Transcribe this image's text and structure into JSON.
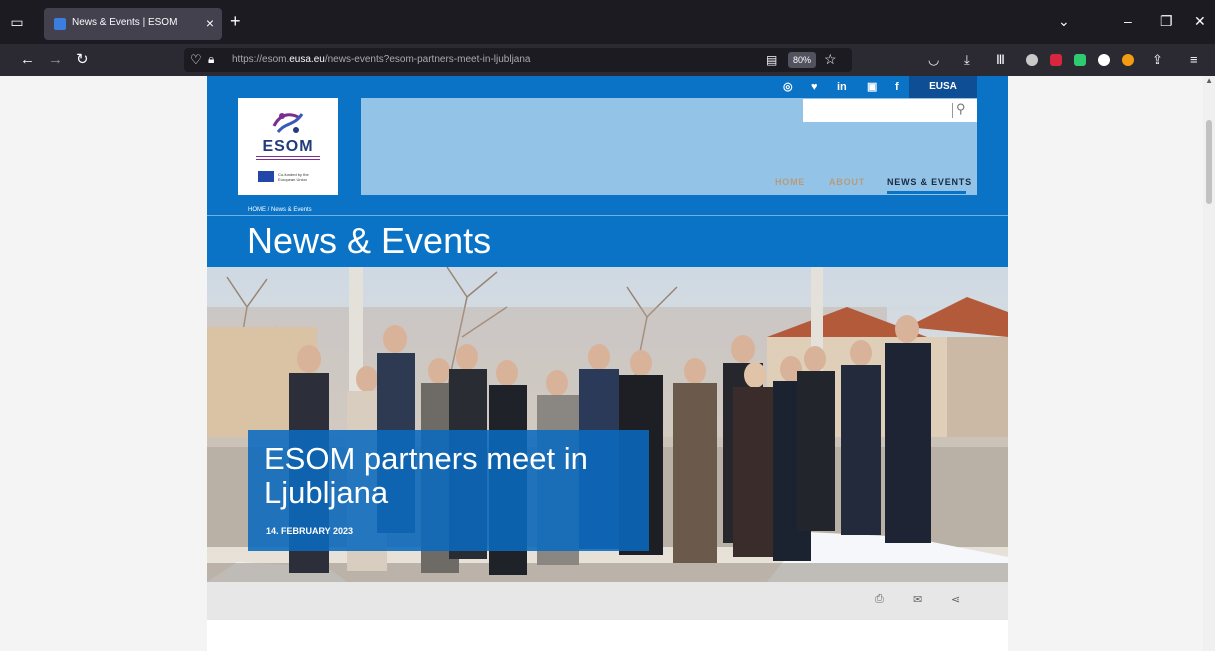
{
  "browser": {
    "tab_title": "News & Events | ESOM",
    "tab_close": "×",
    "new_tab": "+",
    "url_prefix": "https://esom.",
    "url_domain": "eusa.eu",
    "url_path": "/news-events?esom-partners-meet-in-ljubljana",
    "zoom": "80%",
    "icons": [
      "tab-list-icon",
      "back-icon",
      "forward-icon",
      "reload-icon",
      "shield-icon",
      "lock-icon",
      "reader-view-icon",
      "bookmark-star-icon",
      "pocket-icon",
      "downloads-icon",
      "library-icon",
      "extensions-icon",
      "menu-icon"
    ]
  },
  "site": {
    "logo_text": "ESOM",
    "eu_text": "Co-funded by the European Union",
    "eusa_label": "EUSA",
    "social": [
      "instagram-icon",
      "twitter-icon",
      "linkedin-icon",
      "youtube-icon",
      "facebook-icon"
    ],
    "social_glyphs": {
      "instagram": "◎",
      "twitter": "♥",
      "linkedin": "in",
      "youtube": "▣",
      "facebook": "f"
    },
    "search_placeholder": "",
    "menu": [
      {
        "label": "HOME"
      },
      {
        "label": "ABOUT"
      },
      {
        "label": "NEWS & EVENTS"
      }
    ],
    "breadcrumb": "HOME / News & Events",
    "page_title": "News & Events"
  },
  "article": {
    "title": "ESOM partners meet in Ljubljana",
    "date": "14. FEBRUARY 2023"
  },
  "colors": {
    "brand_blue": "#0a73c6",
    "light_blue": "#93c4e8",
    "dark_blue": "#0e4e94"
  }
}
